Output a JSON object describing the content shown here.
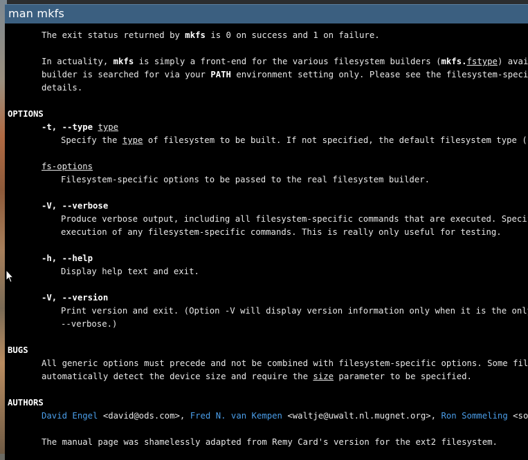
{
  "window": {
    "title": "man mkfs"
  },
  "man": {
    "exit_status": {
      "p1": "The exit status returned by ",
      "cmd": "mkfs",
      "p2": " is 0 on success and 1 on failure."
    },
    "actuality": {
      "l1_a": "In actuality, ",
      "l1_cmd": "mkfs",
      "l1_b": " is simply a front-end for the various filesystem builders (",
      "l1_cmd2": "mkfs.",
      "l1_fstype": "fstype",
      "l1_c": ") available",
      "l2_a": "builder is searched for via your ",
      "l2_path": "PATH",
      "l2_b": " environment setting only. Please see the filesystem-specific bu",
      "l3": "details."
    },
    "options_heading": "OPTIONS",
    "opt_type": {
      "flag": "-t, --type ",
      "arg": "type",
      "desc_a": "Specify the ",
      "desc_arg": "type",
      "desc_b": " of filesystem to be built. If not specified, the default filesystem type (curren"
    },
    "opt_fsoptions": {
      "flag": "fs-options",
      "desc": "Filesystem-specific options to be passed to the real filesystem builder."
    },
    "opt_verbose": {
      "flag": "-V, --verbose",
      "desc1": "Produce verbose output, including all filesystem-specific commands that are executed. Specifying",
      "desc2": "execution of any filesystem-specific commands. This is really only useful for testing."
    },
    "opt_help": {
      "flag": "-h, --help",
      "desc": "Display help text and exit."
    },
    "opt_version": {
      "flag": "-V, --version",
      "desc1": "Print version and exit. (Option -V will display version information only when it is the only para",
      "desc2": "--verbose.)"
    },
    "bugs_heading": "BUGS",
    "bugs": {
      "l1": "All generic options must precede and not be combined with filesystem-specific options. Some filesyste",
      "l2_a": "automatically detect the device size and require the ",
      "l2_size": "size",
      "l2_b": " parameter to be specified."
    },
    "authors_heading": "AUTHORS",
    "authors": {
      "a1_name": "David Engel",
      "a1_email": " <david@ods.com>, ",
      "a2_name": "Fred N. van Kempen",
      "a2_email": " <waltje@uwalt.nl.mugnet.org>, ",
      "a3_name": "Ron Sommeling",
      "a3_email": " <sommel@s",
      "adapted": "The manual page was shamelessly adapted from Remy Card's version for the ext2 filesystem."
    }
  },
  "colors": {
    "titlebar": "#3b5f80",
    "terminal_bg": "#000000",
    "link": "#4a9de8"
  },
  "icons": {
    "pointer": "mouse-pointer-icon"
  }
}
